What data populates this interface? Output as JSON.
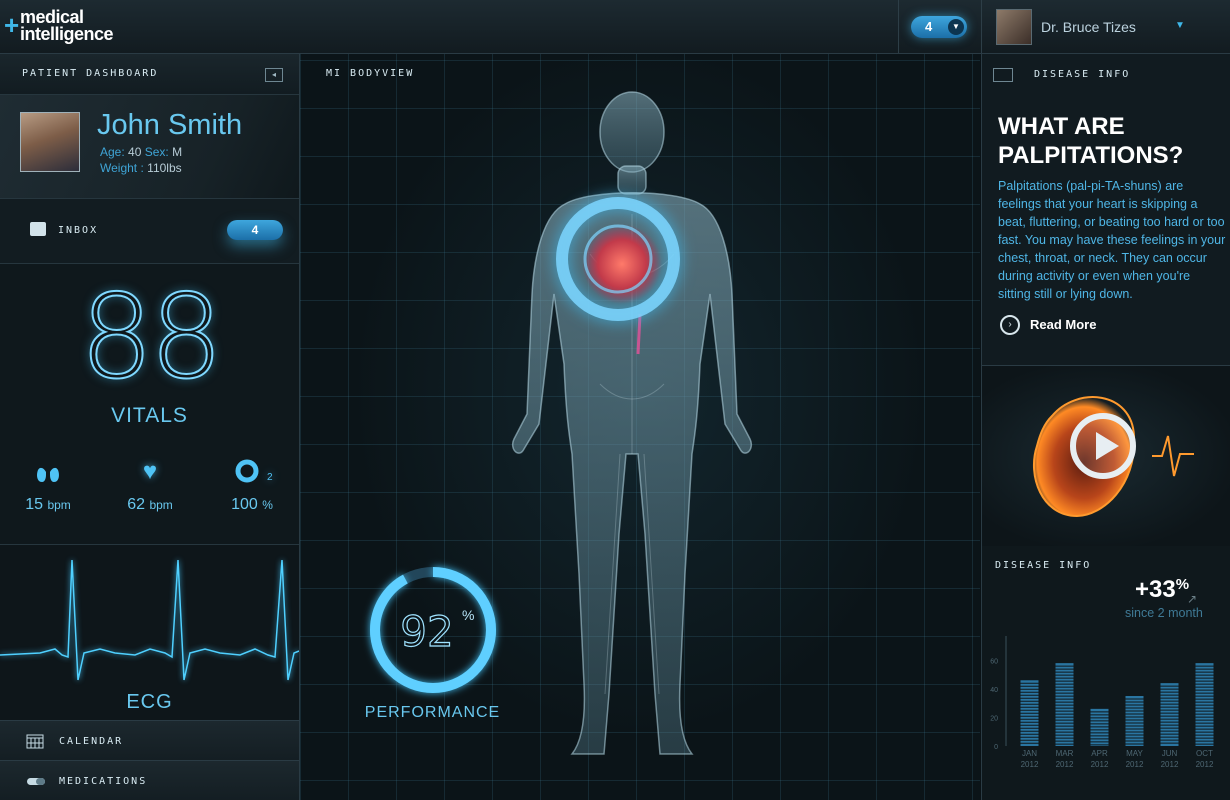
{
  "brand": {
    "logo_line1": "medical",
    "logo_line2": "intelligence",
    "logo_plus": "+"
  },
  "header": {
    "notification_count": "4",
    "user_name": "Dr. Bruce Tizes"
  },
  "left": {
    "dashboard_title": "PATIENT DASHBOARD",
    "patient": {
      "name": "John Smith",
      "age_label": "Age:",
      "age_value": "40",
      "sex_label": "Sex:",
      "sex_value": "M",
      "weight_label": "Weight :",
      "weight_value": "110lbs"
    },
    "inbox": {
      "label": "INBOX",
      "count": "4"
    },
    "vitals": {
      "value": "88",
      "label": "VITALS",
      "stats": [
        {
          "icon": "lungs-icon",
          "value": "15",
          "unit": "bpm"
        },
        {
          "icon": "heart-icon",
          "value": "62",
          "unit": "bpm"
        },
        {
          "icon": "o2-icon",
          "value": "100",
          "unit": "%",
          "icon_subscript": "2"
        }
      ]
    },
    "ecg_label": "ECG",
    "nav": [
      {
        "label": "CALENDAR",
        "icon": "calendar-icon"
      },
      {
        "label": "MEDICATIONS",
        "icon": "pill-icon"
      }
    ]
  },
  "center": {
    "title": "MI BODYVIEW",
    "performance": {
      "value": "92",
      "unit": "%",
      "label": "PERFORMANCE",
      "fraction": 0.92
    }
  },
  "right": {
    "disease_info_title": "DISEASE INFO",
    "article_title": "WHAT ARE PALPITATIONS?",
    "article_body": "Palpitations (pal-pi-TA-shuns) are feelings that your heart is skipping a beat, fluttering, or beating too hard or too fast. You may have these feelings in your chest, throat, or neck. They can occur during activity or even when you're sitting still or lying down.",
    "read_more": "Read More",
    "stats_title": "DISEASE INFO",
    "stats_change": "+33",
    "stats_change_unit": "%",
    "stats_sub": "since 2 month"
  },
  "chart_data": {
    "type": "bar",
    "categories": [
      "JAN 2012",
      "MAR 2012",
      "APR 2012",
      "MAY 2012",
      "JUN 2012",
      "OCT 2012"
    ],
    "values": [
      46,
      58,
      26,
      35,
      44,
      58
    ],
    "ylim": [
      0,
      70
    ],
    "yticks": [
      0,
      20,
      40,
      60
    ],
    "bar_color": "#2f86b8"
  },
  "colors": {
    "accent": "#3fb7e8",
    "text_blue": "#69c8ef",
    "bg": "#0a1216"
  }
}
